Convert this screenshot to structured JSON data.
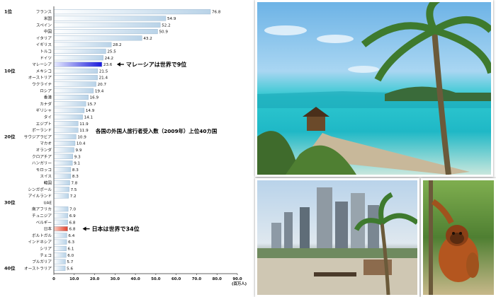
{
  "chart_data": {
    "type": "bar",
    "orientation": "horizontal",
    "title": "各国の外国人旅行者受入数（2009年）上位40カ国",
    "unit_label": "(百万人)",
    "xlim": [
      0,
      90
    ],
    "x_ticks": [
      "0",
      "10.0",
      "20.0",
      "30.0",
      "40.0",
      "50.0",
      "60.0",
      "70.0",
      "80.0",
      "90.0"
    ],
    "rank_labels": [
      {
        "rank": 1,
        "text": "1位"
      },
      {
        "rank": 10,
        "text": "10位"
      },
      {
        "rank": 20,
        "text": "20位"
      },
      {
        "rank": 30,
        "text": "30位"
      },
      {
        "rank": 40,
        "text": "40位"
      }
    ],
    "categories": [
      "フランス",
      "米国",
      "スペイン",
      "中国",
      "イタリア",
      "イギリス",
      "トルコ",
      "ドイツ",
      "マレーシア",
      "メキシコ",
      "オーストリア",
      "ウクライナ",
      "ロシア",
      "香港",
      "カナダ",
      "ギリシャ",
      "タイ",
      "エジプト",
      "ポーランド",
      "サウジアラビア",
      "マカオ",
      "オランダ",
      "クロアチア",
      "ハンガリー",
      "モロッコ",
      "スイス",
      "韓国",
      "シンガポール",
      "アイルランド",
      "UAE",
      "南アフリカ",
      "チュニジア",
      "ベルギー",
      "日本",
      "ボルトガル",
      "インドネシア",
      "シリア",
      "チェコ",
      "ブルガリア",
      "オーストラリア"
    ],
    "values": [
      76.8,
      54.9,
      52.2,
      50.9,
      43.2,
      28.2,
      25.5,
      24.2,
      23.6,
      21.5,
      21.4,
      20.7,
      19.4,
      16.9,
      15.7,
      14.9,
      14.1,
      11.9,
      11.9,
      10.9,
      10.4,
      9.9,
      9.3,
      9.1,
      8.3,
      8.3,
      7.8,
      7.5,
      7.2,
      null,
      7.0,
      6.9,
      6.8,
      6.8,
      6.4,
      6.3,
      6.1,
      6.0,
      5.7,
      5.6
    ],
    "value_labels": [
      "76.8",
      "54.9",
      "52.2",
      "50.9",
      "43.2",
      "28.2",
      "25.5",
      "24.2",
      "23.6",
      "21.5",
      "21.4",
      "20.7",
      "19.4",
      "16.9",
      "15.7",
      "14.9",
      "14.1",
      "11.9",
      "11.9",
      "10.9",
      "10.4",
      "9.9",
      "9.3",
      "9.1",
      "8.3",
      "8.3",
      "7.8",
      "7.5",
      "7.2",
      "",
      "7.0",
      "6.9",
      "6.8",
      "6.8",
      "6.4",
      "6.3",
      "6.1",
      "6.0",
      "5.7",
      "5.6"
    ],
    "highlights": [
      {
        "category": "マレーシア",
        "color": "#1a1adb"
      },
      {
        "category": "日本",
        "color": "#e0402a"
      }
    ],
    "annotations": [
      {
        "category": "マレーシア",
        "text": "マレーシアは世界で9位"
      },
      {
        "category": "日本",
        "text": "日本は世界で34位"
      }
    ],
    "bar_color": "#d8e8f3",
    "grid": false
  },
  "photos": {
    "beach": "beach-photo",
    "city": "city-photo",
    "orangutan": "orangutan-photo"
  }
}
